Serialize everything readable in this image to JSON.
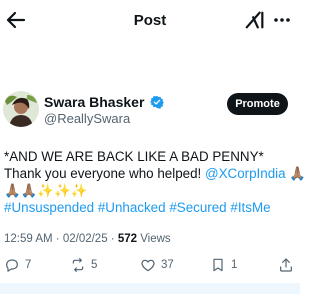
{
  "header": {
    "title": "Post",
    "icons": [
      "back-arrow-icon",
      "grok-icon",
      "more-icon"
    ]
  },
  "author": {
    "name": "Swara Bhasker",
    "handle": "@ReallySwara",
    "verified_color": "#1d9bf0",
    "promote_label": "Promote"
  },
  "tweet": {
    "line1": "*AND WE ARE BACK LIKE A BAD PENNY*",
    "line2_text": "Thank you everyone who helped! ",
    "line2_mention": "@XCorpIndia",
    "line2_emoji": " 🙏🏽",
    "line3_emoji": "🙏🏽🙏🏽✨✨✨",
    "hashtags": [
      "#Unsuspended",
      "#Unhacked",
      "#Secured",
      "#ItsMe"
    ]
  },
  "meta": {
    "time": "12:59 AM",
    "separator": " · ",
    "date": "02/02/25",
    "views_count": "572",
    "views_label": " Views"
  },
  "actions": {
    "replies": "7",
    "reposts": "5",
    "likes": "37",
    "bookmarks": "1"
  },
  "colors": {
    "accent": "#1d9bf0",
    "text": "#0f1419",
    "muted": "#536471"
  }
}
